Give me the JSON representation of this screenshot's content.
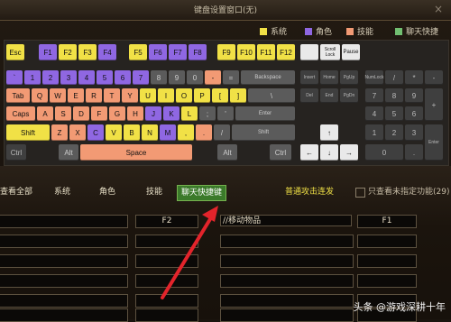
{
  "window": {
    "title": "键盘设置窗口(无)",
    "close_glyph": "×"
  },
  "legend": [
    {
      "label": "系统",
      "color": "#f1e146"
    },
    {
      "label": "角色",
      "color": "#8f67e2"
    },
    {
      "label": "技能",
      "color": "#f29a74"
    },
    {
      "label": "聊天快捷",
      "color": "#71bf71"
    }
  ],
  "keys": {
    "row0": [
      "Esc",
      "F1",
      "F2",
      "F3",
      "F4",
      "F5",
      "F6",
      "F7",
      "F8",
      "F9",
      "F10",
      "F11",
      "F12",
      "",
      "Scroll Lock",
      "Pause"
    ],
    "row1": [
      "`",
      "1",
      "2",
      "3",
      "4",
      "5",
      "6",
      "7",
      "8",
      "9",
      "0",
      "-",
      "=",
      "Backspace",
      "Insert",
      "Home",
      "PgUp",
      "NumLock",
      "/",
      "*",
      "-"
    ],
    "row2": [
      "Tab",
      "Q",
      "W",
      "E",
      "R",
      "T",
      "Y",
      "U",
      "I",
      "O",
      "P",
      "[",
      "]",
      "\\",
      "Del",
      "End",
      "PgDn",
      "7",
      "8",
      "9",
      "+"
    ],
    "row3": [
      "Caps",
      "A",
      "S",
      "D",
      "F",
      "G",
      "H",
      "J",
      "K",
      "L",
      ";",
      "'",
      "Enter",
      "4",
      "5",
      "6"
    ],
    "row4": [
      "Shift",
      "Z",
      "X",
      "C",
      "V",
      "B",
      "N",
      "M",
      ",",
      ".",
      "/",
      "Shift",
      "↑",
      "1",
      "2",
      "3",
      "Enter"
    ],
    "row5": [
      "Ctrl",
      "Alt",
      "Space",
      "Alt",
      "Ctrl",
      "←",
      "↓",
      "→",
      "0",
      "."
    ]
  },
  "tabs": {
    "all": "查看全部",
    "system": "系统",
    "role": "角色",
    "skill": "技能",
    "chat": "聊天快捷键",
    "normal_attack": "普通攻击连发",
    "only_unassigned": "只查看未指定功能(29)"
  },
  "list_rows": [
    {
      "left": "",
      "key1": "F2",
      "desc": "//移动物品",
      "key2": "F1"
    },
    {
      "left": "",
      "key1": "",
      "desc": "",
      "key2": ""
    },
    {
      "left": "",
      "key1": "",
      "desc": "",
      "key2": ""
    },
    {
      "left": "",
      "key1": "",
      "desc": "",
      "key2": ""
    },
    {
      "left": "",
      "key1": "",
      "desc": "",
      "key2": ""
    },
    {
      "left": "",
      "key1": "",
      "desc": "",
      "key2": ""
    }
  ],
  "watermark": "头条 @游戏深耕十年"
}
